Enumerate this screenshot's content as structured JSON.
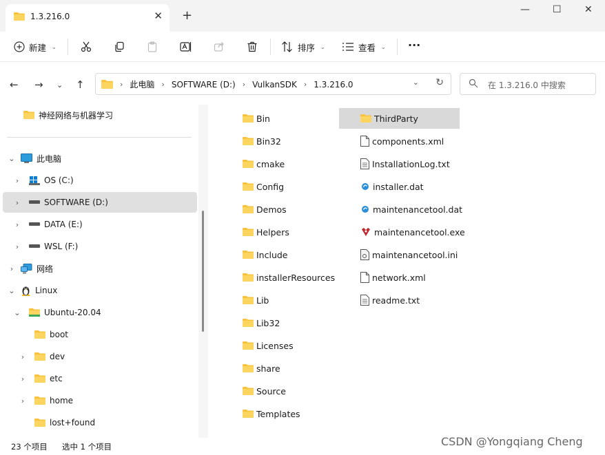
{
  "tab": {
    "title": "1.3.216.0",
    "close": "✕",
    "new_tab": "+"
  },
  "window": {
    "minimize": "—",
    "maximize": "☐",
    "close": "✕"
  },
  "toolbar": {
    "new_label": "新建",
    "sort_label": "排序",
    "view_label": "查看",
    "more_label": "···"
  },
  "address": {
    "crumbs": [
      "此电脑",
      "SOFTWARE (D:)",
      "VulkanSDK",
      "1.3.216.0"
    ],
    "search_placeholder": "在 1.3.216.0 中搜索"
  },
  "nav": {
    "pinned": "神经网络与机器学习",
    "this_pc": "此电脑",
    "drives": [
      "OS (C:)",
      "SOFTWARE (D:)",
      "DATA (E:)",
      "WSL (F:)"
    ],
    "network": "网络",
    "linux": "Linux",
    "ubuntu": "Ubuntu-20.04",
    "ubuntu_children": [
      "boot",
      "dev",
      "etc",
      "home",
      "lost+found"
    ]
  },
  "files": {
    "folders": [
      "Bin",
      "Bin32",
      "cmake",
      "Config",
      "Demos",
      "Helpers",
      "Include",
      "installerResources",
      "Lib",
      "Lib32",
      "Licenses",
      "share",
      "Source",
      "Templates"
    ],
    "col2": [
      {
        "name": "ThirdParty",
        "icon": "folder-icon"
      },
      {
        "name": "components.xml",
        "icon": "document-icon"
      },
      {
        "name": "InstallationLog.txt",
        "icon": "text-file-icon"
      },
      {
        "name": "installer.dat",
        "icon": "dat-file-icon"
      },
      {
        "name": "maintenancetool.dat",
        "icon": "dat-file-icon"
      },
      {
        "name": "maintenancetool.exe",
        "icon": "exe-app-icon"
      },
      {
        "name": "maintenancetool.ini",
        "icon": "ini-settings-icon"
      },
      {
        "name": "network.xml",
        "icon": "document-icon"
      },
      {
        "name": "readme.txt",
        "icon": "text-file-icon"
      }
    ]
  },
  "status": {
    "count": "23 个项目",
    "selected": "选中 1 个项目"
  },
  "watermark": "CSDN @Yongqiang Cheng",
  "colors": {
    "folder": "#f8c33a",
    "selection": "#d9d9d9",
    "accent": "#0067c0"
  }
}
